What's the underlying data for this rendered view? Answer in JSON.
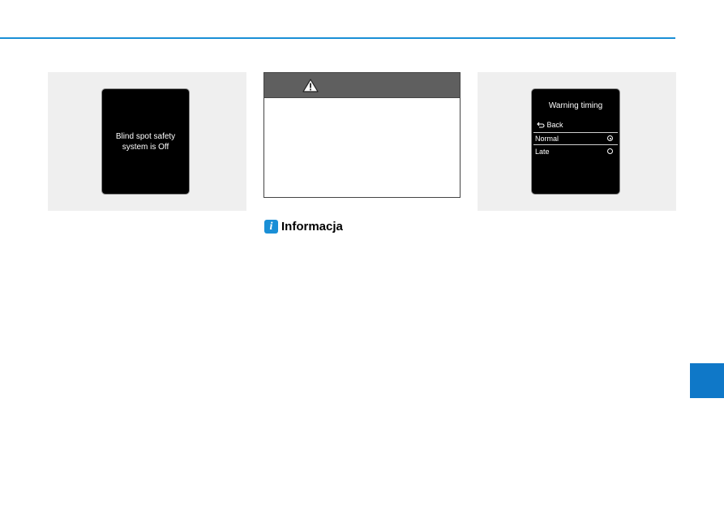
{
  "left_figure": {
    "display_message": "Blind spot safety\nsystem is Off"
  },
  "warning": {
    "icon": "warning-triangle-icon",
    "header_color": "#5f5f5f"
  },
  "info": {
    "icon": "info-icon",
    "icon_glyph": "i",
    "label": "Informacja",
    "accent": "#1a8fd6"
  },
  "right_figure": {
    "title": "Warning timing",
    "back_icon": "back-arrow-icon",
    "back_label": "Back",
    "options": [
      {
        "label": "Normal",
        "selected": true
      },
      {
        "label": "Late",
        "selected": false
      }
    ]
  },
  "colors": {
    "rule": "#1a8fd6",
    "side_tab": "#0f78c8",
    "figure_bg": "#efefef"
  }
}
